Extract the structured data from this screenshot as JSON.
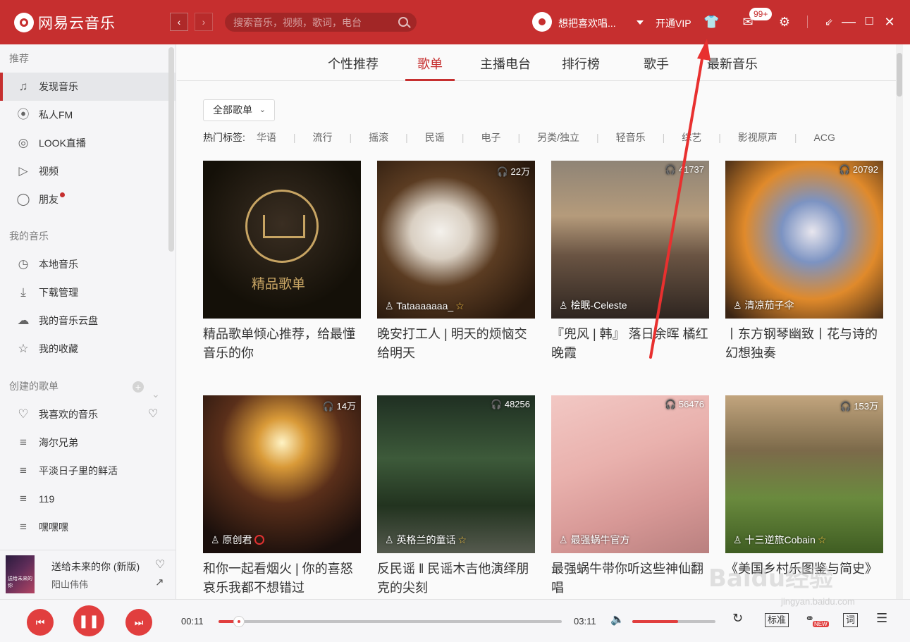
{
  "app": {
    "name": "网易云音乐"
  },
  "search": {
    "placeholder": "搜索音乐，视频，歌词，电台"
  },
  "user": {
    "name": "想把喜欢唱..."
  },
  "header": {
    "vip": "开通VIP",
    "msg_badge": "99+"
  },
  "sidebar": {
    "sections": [
      {
        "title": "推荐",
        "items": [
          {
            "label": "发现音乐",
            "icon": "music-note-icon",
            "active": true
          },
          {
            "label": "私人FM",
            "icon": "radio-icon"
          },
          {
            "label": "LOOK直播",
            "icon": "live-icon"
          },
          {
            "label": "视频",
            "icon": "video-icon"
          },
          {
            "label": "朋友",
            "icon": "friends-icon",
            "dot": true
          }
        ]
      },
      {
        "title": "我的音乐",
        "items": [
          {
            "label": "本地音乐",
            "icon": "local-music-icon"
          },
          {
            "label": "下载管理",
            "icon": "download-icon"
          },
          {
            "label": "我的音乐云盘",
            "icon": "cloud-icon"
          },
          {
            "label": "我的收藏",
            "icon": "collection-icon"
          }
        ]
      },
      {
        "title": "创建的歌单",
        "items": [
          {
            "label": "我喜欢的音乐",
            "icon": "heart-icon"
          },
          {
            "label": "海尔兄弟",
            "icon": "playlist-icon"
          },
          {
            "label": "平淡日子里的鲜活",
            "icon": "playlist-icon"
          },
          {
            "label": "119",
            "icon": "playlist-icon"
          },
          {
            "label": "嘿嘿嘿",
            "icon": "playlist-icon"
          }
        ]
      }
    ]
  },
  "now_playing": {
    "title": "送给未来的你 (新版)",
    "artist": "阳山伟伟",
    "cover_text": "送给未来的你"
  },
  "tabs": [
    "个性推荐",
    "歌单",
    "主播电台",
    "排行榜",
    "歌手",
    "最新音乐"
  ],
  "active_tab": "歌单",
  "filter": {
    "all_label": "全部歌单",
    "hot_label": "热门标签:",
    "tags": [
      "华语",
      "流行",
      "摇滚",
      "民谣",
      "电子",
      "另类/独立",
      "轻音乐",
      "综艺",
      "影视原声",
      "ACG"
    ]
  },
  "featured_label": "精品歌单",
  "playlists": [
    {
      "title": "精品歌单倾心推荐，给最懂音乐的你",
      "plays": "",
      "creator": "",
      "badge": ""
    },
    {
      "title": "晚安打工人 | 明天的烦恼交给明天",
      "plays": "22万",
      "creator": "Tataaaaaaa_",
      "badge": "star"
    },
    {
      "title": "『兜风 | 韩』 落日余晖 橘红晚霞",
      "plays": "41737",
      "creator": "桧眠-Celeste",
      "badge": ""
    },
    {
      "title": "丨东方钢琴幽致丨花与诗的幻想独奏",
      "plays": "20792",
      "creator": "清凉茄子伞",
      "badge": ""
    },
    {
      "title": "和你一起看烟火 | 你的喜怒哀乐我都不想错过",
      "plays": "14万",
      "creator": "原创君",
      "badge": "music"
    },
    {
      "title": "反民谣 ‖ 民谣木吉他演绎朋克的尖刻",
      "plays": "48256",
      "creator": "英格兰的童话",
      "badge": "star"
    },
    {
      "title": "最强蜗牛带你听这些神仙翻唱",
      "plays": "56476",
      "creator": "最强蜗牛官方",
      "badge": ""
    },
    {
      "title": "《美国乡村乐图鉴与简史》",
      "plays": "153万",
      "creator": "十三逆旅Cobain",
      "badge": "star"
    }
  ],
  "player": {
    "current": "00:11",
    "total": "03:11",
    "progress": 0.06,
    "volume": 0.55,
    "quality": "标准",
    "lyric": "词"
  },
  "watermark": {
    "main": "Baidu经验",
    "sub": "jingyan.baidu.com"
  }
}
